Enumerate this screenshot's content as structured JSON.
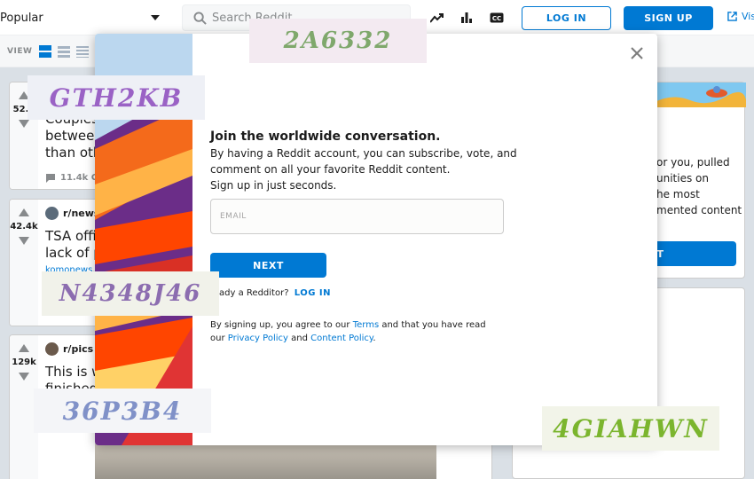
{
  "header": {
    "feed_label": "Popular",
    "search_placeholder": "Search Reddit",
    "login_label": "LOG IN",
    "signup_label": "SIGN UP",
    "visit_label": "Vis"
  },
  "viewbar": {
    "label": "VIEW"
  },
  "posts": [
    {
      "score": "52.0",
      "title_lines": [
        "Couples",
        "between",
        "than oth"
      ],
      "comments": "11.4k Co"
    },
    {
      "score": "42.4k",
      "subreddit": "r/news",
      "title_lines": [
        "TSA offic",
        "lack of p"
      ],
      "link": "komonews.c"
    },
    {
      "score": "129k",
      "subreddit": "r/pics",
      "title_lines": [
        "This is w",
        "finished"
      ]
    }
  ],
  "sidebar": {
    "lines": [
      "or you, pulled",
      "unities on",
      "he most",
      "mented content"
    ],
    "button_label": "T"
  },
  "modal": {
    "title": "Join the worldwide conversation.",
    "subtitle_1": "By having a Reddit account, you can subscribe, vote, and",
    "subtitle_2": "comment on all your favorite Reddit content.",
    "subtitle_3": "Sign up in just seconds.",
    "email_placeholder": "EMAIL",
    "next_label": "NEXT",
    "already_text": "ready a Redditor?",
    "login_link": "LOG IN",
    "terms_prefix": "By signing up, you agree to our",
    "terms_link": "Terms",
    "terms_middle": "and that you have read our",
    "privacy_link": "Privacy Policy",
    "and_text": "and",
    "content_link": "Content Policy",
    "period": "."
  },
  "captchas": [
    "2A6332",
    "GTH2KB",
    "N4348J46",
    "36P3B4",
    "4GIAHWN"
  ],
  "colors": {
    "accent": "#0079d3",
    "background": "#dae0e6"
  }
}
